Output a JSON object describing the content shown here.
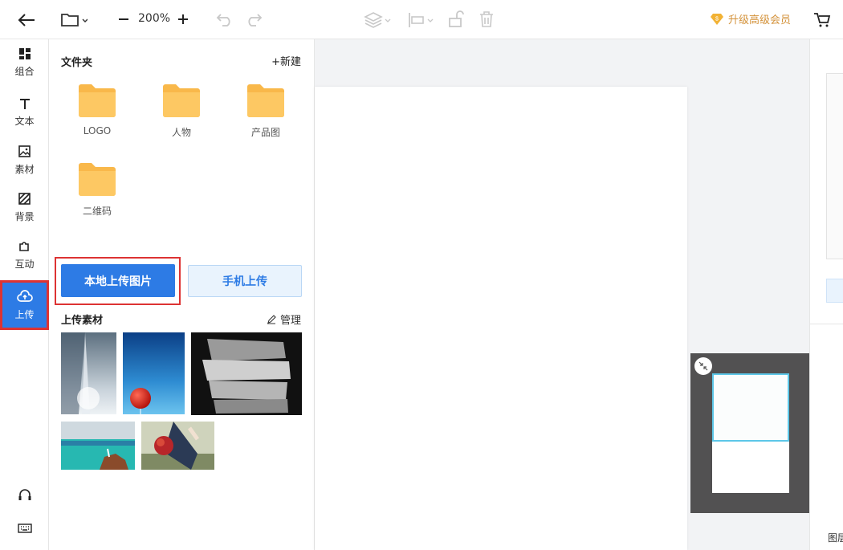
{
  "toolbar": {
    "zoom": "200%",
    "upgrade_label": "升级高级会员"
  },
  "rail": {
    "items": [
      {
        "label": "组合",
        "icon": "grid-icon"
      },
      {
        "label": "文本",
        "icon": "text-icon"
      },
      {
        "label": "素材",
        "icon": "image-icon"
      },
      {
        "label": "背景",
        "icon": "hatch-icon"
      },
      {
        "label": "互动",
        "icon": "puzzle-icon"
      },
      {
        "label": "上传",
        "icon": "cloud-upload-icon",
        "active": true
      }
    ]
  },
  "panel": {
    "folders_title": "文件夹",
    "new_label": "+新建",
    "folders": [
      "LOGO",
      "人物",
      "产品图",
      "二维码"
    ],
    "upload_local_label": "本地上传图片",
    "upload_mobile_label": "手机上传",
    "uploads_title": "上传素材",
    "manage_label": "管理"
  },
  "right_panel": {
    "layers_label": "图层"
  },
  "colors": {
    "accent": "#2d7be5",
    "highlight": "#dd3333",
    "folder": "#fcc35a",
    "upgrade": "#d4933c"
  }
}
